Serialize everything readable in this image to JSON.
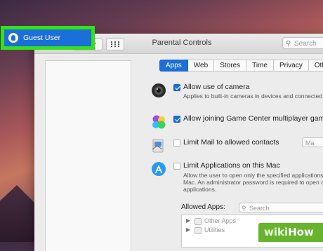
{
  "window": {
    "title": "Parental Controls",
    "search_placeholder": "Search",
    "nav_back": "‹",
    "nav_forward": "›"
  },
  "sidebar": {
    "users": [
      {
        "label": "Guest User",
        "selected": true
      }
    ]
  },
  "tabs": [
    {
      "label": "Apps",
      "active": true
    },
    {
      "label": "Web",
      "active": false
    },
    {
      "label": "Stores",
      "active": false
    },
    {
      "label": "Time",
      "active": false
    },
    {
      "label": "Privacy",
      "active": false
    },
    {
      "label": "Othe",
      "active": false
    }
  ],
  "settings": {
    "camera": {
      "label": "Allow use of camera",
      "description": "Applies to built-in cameras in devices and connected",
      "checked": true,
      "icon": "camera-icon"
    },
    "game_center": {
      "label": "Allow joining Game Center multiplayer games",
      "checked": true,
      "icon": "game-center-icon"
    },
    "mail": {
      "label": "Limit Mail to allowed contacts",
      "checked": false,
      "icon": "mail-icon",
      "button_label": "Ma"
    },
    "applications": {
      "label": "Limit Applications on this Mac",
      "description_line1": "Allow the user to open only the specified applications",
      "description_line2": "Mac. An administrator password is required to open ot",
      "description_line3": "applications.",
      "checked": false,
      "icon": "app-store-icon"
    }
  },
  "allowed_apps": {
    "label": "Allowed Apps:",
    "search_placeholder": "Search",
    "items": [
      {
        "name": "Other Apps"
      },
      {
        "name": "Utilities"
      }
    ]
  },
  "watermark": {
    "part1": "wiki",
    "part2": "How"
  },
  "colors": {
    "accent": "#1a6fd8",
    "highlight": "#34e11a",
    "watermark": "#66b32e"
  }
}
